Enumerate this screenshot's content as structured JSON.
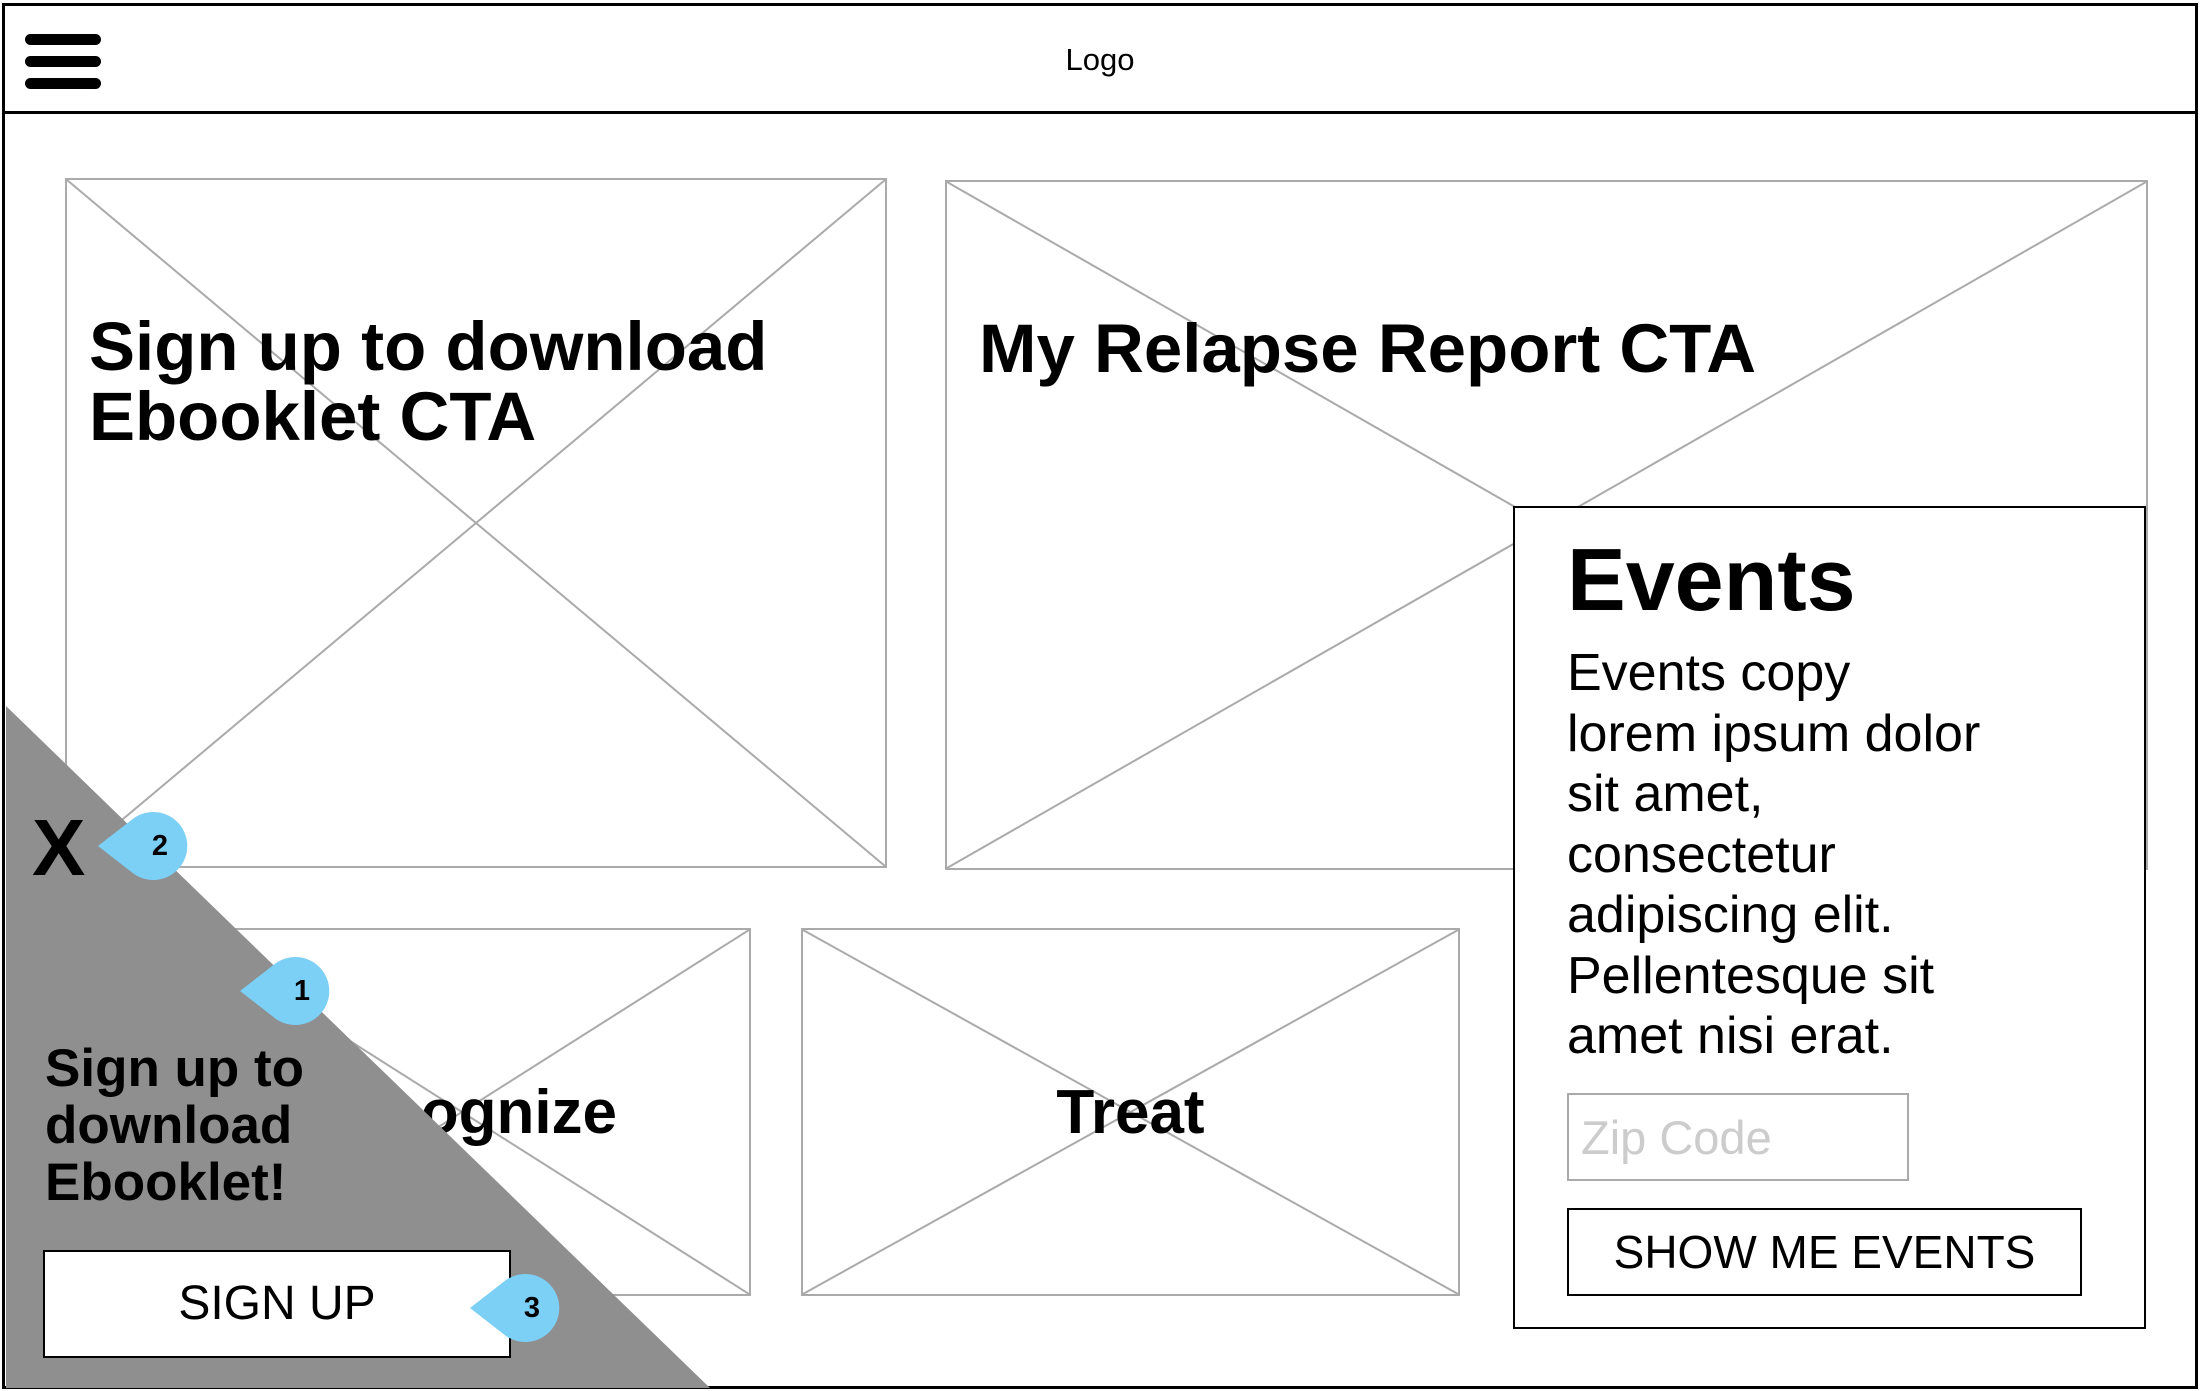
{
  "header": {
    "logo_text": "Logo",
    "menu_icon": "hamburger-menu-icon"
  },
  "main": {
    "ebooklet_cta": {
      "line1": "Sign up to download",
      "line2": "Ebooklet CTA"
    },
    "relapse_cta": {
      "title": "My Relapse Report CTA"
    },
    "tiles": [
      {
        "title": "Recognize"
      },
      {
        "title": "Treat"
      }
    ]
  },
  "events": {
    "title": "Events",
    "copy_lines": [
      "Events copy",
      "lorem ipsum dolor",
      "sit amet,",
      "consectetur",
      "adipiscing elit.",
      "Pellentesque sit",
      "amet nisi erat."
    ],
    "zip_placeholder": "Zip Code",
    "button_label": "SHOW ME EVENTS"
  },
  "popup": {
    "close_label": "X",
    "text_lines": [
      "Sign up to",
      "download",
      "Ebooklet!"
    ],
    "button_label": "SIGN UP",
    "background_color": "#8f8f8f"
  },
  "annotations": {
    "markers": [
      "1",
      "2",
      "3"
    ],
    "color": "#7ccff5"
  }
}
